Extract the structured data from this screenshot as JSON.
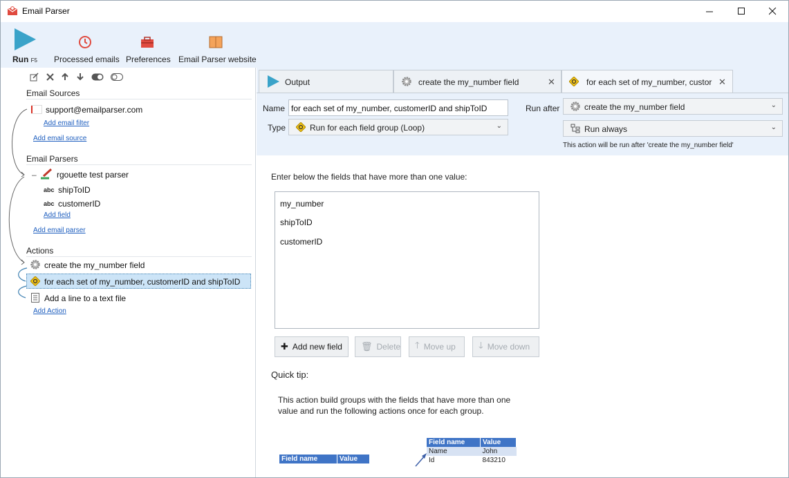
{
  "window": {
    "title": "Email Parser"
  },
  "ribbon": {
    "run_label": "Run",
    "run_shortcut": "F5",
    "processed_label": "Processed emails",
    "preferences_label": "Preferences",
    "website_label": "Email Parser website"
  },
  "tree": {
    "email_sources_header": "Email Sources",
    "source_email": "support@emailparser.com",
    "add_email_filter": "Add email filter",
    "add_email_source": "Add email source",
    "email_parsers_header": "Email Parsers",
    "parser_name": "rgouette test parser",
    "field_type": "abc",
    "fields": [
      "shipToID",
      "customerID"
    ],
    "add_field": "Add field",
    "add_email_parser": "Add email parser",
    "actions_header": "Actions",
    "actions": [
      "create the my_number field",
      "for each set of my_number, customerID and shipToID",
      "Add a line to a text file"
    ],
    "add_action": "Add Action"
  },
  "tabs": [
    {
      "label": "Output"
    },
    {
      "label": "create the my_number field"
    },
    {
      "label": "for each set of my_number, custor"
    }
  ],
  "properties": {
    "name_label": "Name",
    "name_value": "for each set of my_number, customerID and shipToID",
    "type_label": "Type",
    "type_value": "Run for each field group (Loop)",
    "run_after_label": "Run after",
    "run_after_value": "create the my_number field",
    "run_condition_value": "Run always",
    "run_after_hint": "This action will be run after 'create the my_number field'"
  },
  "content": {
    "instruction": "Enter below the fields that have more than one value:",
    "fields_list": [
      "my_number",
      "shipToID",
      "customerID"
    ],
    "buttons": {
      "add_new_field": "Add new field",
      "delete": "Delete",
      "move_up": "Move up",
      "move_down": "Move down"
    },
    "quick_tip_header": "Quick tip:",
    "quick_tip_line1": "This action build groups with the fields that have more than one",
    "quick_tip_line2": "value and run the following actions once for each group.",
    "example_table_left": {
      "headers": [
        "Field name",
        "Value"
      ]
    },
    "example_table_right": {
      "headers": [
        "Field name",
        "Value"
      ],
      "rows": [
        [
          "Name",
          "John"
        ],
        [
          "Id",
          "843210"
        ]
      ]
    }
  },
  "colors": {
    "accent": "#1f5fbf",
    "ribbon_bg": "#e9f1fb",
    "selection": "#cce4f7",
    "table_header": "#3f74c6"
  }
}
